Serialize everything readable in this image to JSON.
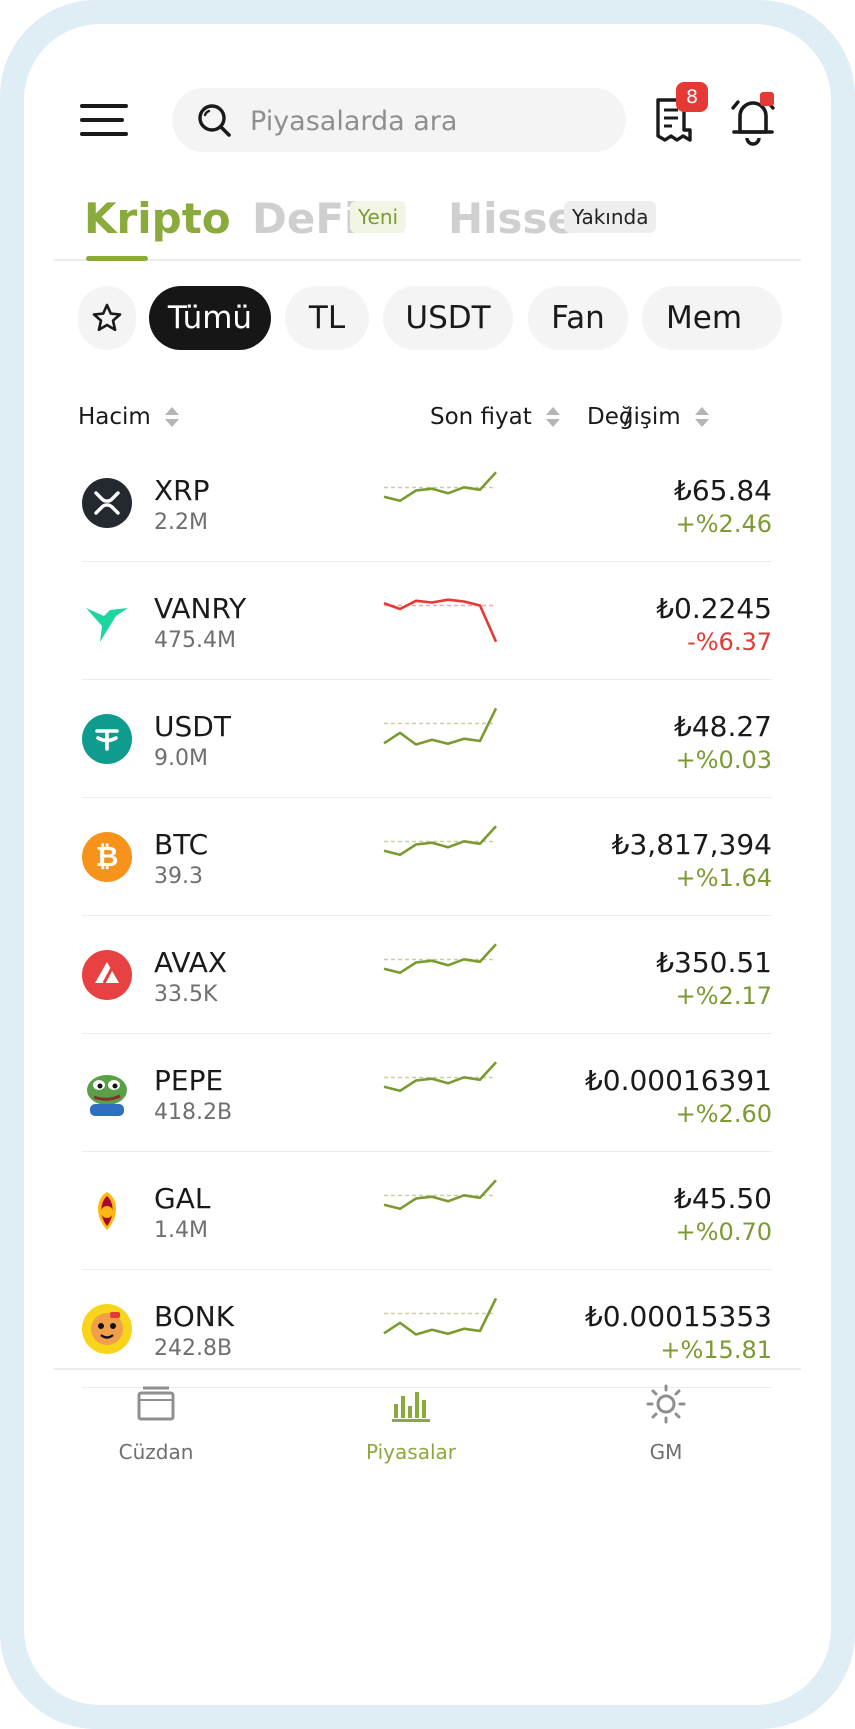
{
  "header": {
    "search_placeholder": "Piyasalarda ara",
    "orders_badge": "8"
  },
  "tabs": [
    {
      "label": "Kripto",
      "active": true
    },
    {
      "label": "DeFi",
      "tag": "Yeni"
    },
    {
      "label": "Hisse",
      "tag": "Yakında"
    }
  ],
  "filters": [
    {
      "label": "★",
      "icon": "star-icon"
    },
    {
      "label": "Tümü",
      "active": true
    },
    {
      "label": "TL"
    },
    {
      "label": "USDT"
    },
    {
      "label": "Fan"
    },
    {
      "label": "Mem"
    }
  ],
  "columns": {
    "volume": "Hacim",
    "price": "Son fiyat",
    "separator": "/",
    "change": "Değişim"
  },
  "assets": [
    {
      "symbol": "XRP",
      "volume": "2.2M",
      "price": "₺65.84",
      "change": "+%2.46",
      "trend": "up",
      "logo": "xrp-logo-icon",
      "color": "#23292f",
      "spark": [
        0.55,
        0.38,
        0.82,
        0.9,
        0.7,
        0.96,
        0.85,
        1.6
      ]
    },
    {
      "symbol": "VANRY",
      "volume": "475.4M",
      "price": "₺0.2245",
      "change": "-%6.37",
      "trend": "down",
      "logo": "vanry-logo-icon",
      "color": "#1dd5a0",
      "spark": [
        1.05,
        0.8,
        1.15,
        1.08,
        1.2,
        1.12,
        0.95,
        -0.6
      ]
    },
    {
      "symbol": "USDT",
      "volume": "9.0M",
      "price": "₺48.27",
      "change": "+%0.03",
      "trend": "up",
      "logo": "usdt-logo-icon",
      "color": "#0f9b8e",
      "spark": [
        0.1,
        0.55,
        0.05,
        0.25,
        0.08,
        0.3,
        0.2,
        1.6
      ]
    },
    {
      "symbol": "BTC",
      "volume": "39.3",
      "price": "₺3,817,394",
      "change": "+%1.64",
      "trend": "up",
      "logo": "btc-logo-icon",
      "color": "#f7931a",
      "spark": [
        0.55,
        0.38,
        0.82,
        0.9,
        0.7,
        0.96,
        0.85,
        1.6
      ]
    },
    {
      "symbol": "AVAX",
      "volume": "33.5K",
      "price": "₺350.51",
      "change": "+%2.17",
      "trend": "up",
      "logo": "avax-logo-icon",
      "color": "#e84142",
      "spark": [
        0.55,
        0.38,
        0.82,
        0.9,
        0.7,
        0.96,
        0.85,
        1.6
      ]
    },
    {
      "symbol": "PEPE",
      "volume": "418.2B",
      "price": "₺0.00016391",
      "change": "+%2.60",
      "trend": "up",
      "logo": "pepe-logo-icon",
      "color": "#4c8f3a",
      "spark": [
        0.55,
        0.38,
        0.82,
        0.9,
        0.7,
        0.96,
        0.85,
        1.6
      ]
    },
    {
      "symbol": "GAL",
      "volume": "1.4M",
      "price": "₺45.50",
      "change": "+%0.70",
      "trend": "up",
      "logo": "gal-logo-icon",
      "color": "#fdb912",
      "spark": [
        0.55,
        0.38,
        0.82,
        0.9,
        0.7,
        0.96,
        0.85,
        1.6
      ]
    },
    {
      "symbol": "BONK",
      "volume": "242.8B",
      "price": "₺0.00015353",
      "change": "+%15.81",
      "trend": "up",
      "logo": "bonk-logo-icon",
      "color": "#f8d41a",
      "spark": [
        0.1,
        0.55,
        0.05,
        0.25,
        0.08,
        0.3,
        0.2,
        1.6
      ]
    }
  ],
  "bottom_nav": [
    {
      "label": "Cüzdan",
      "icon": "wallet-icon"
    },
    {
      "label": "Piyasalar",
      "icon": "bar-chart-icon",
      "active": true
    },
    {
      "label": "GM",
      "icon": "sun-icon"
    }
  ],
  "colors": {
    "accent": "#8aab3c",
    "up": "#7c9a32",
    "down": "#e53935",
    "badge": "#e53935"
  }
}
